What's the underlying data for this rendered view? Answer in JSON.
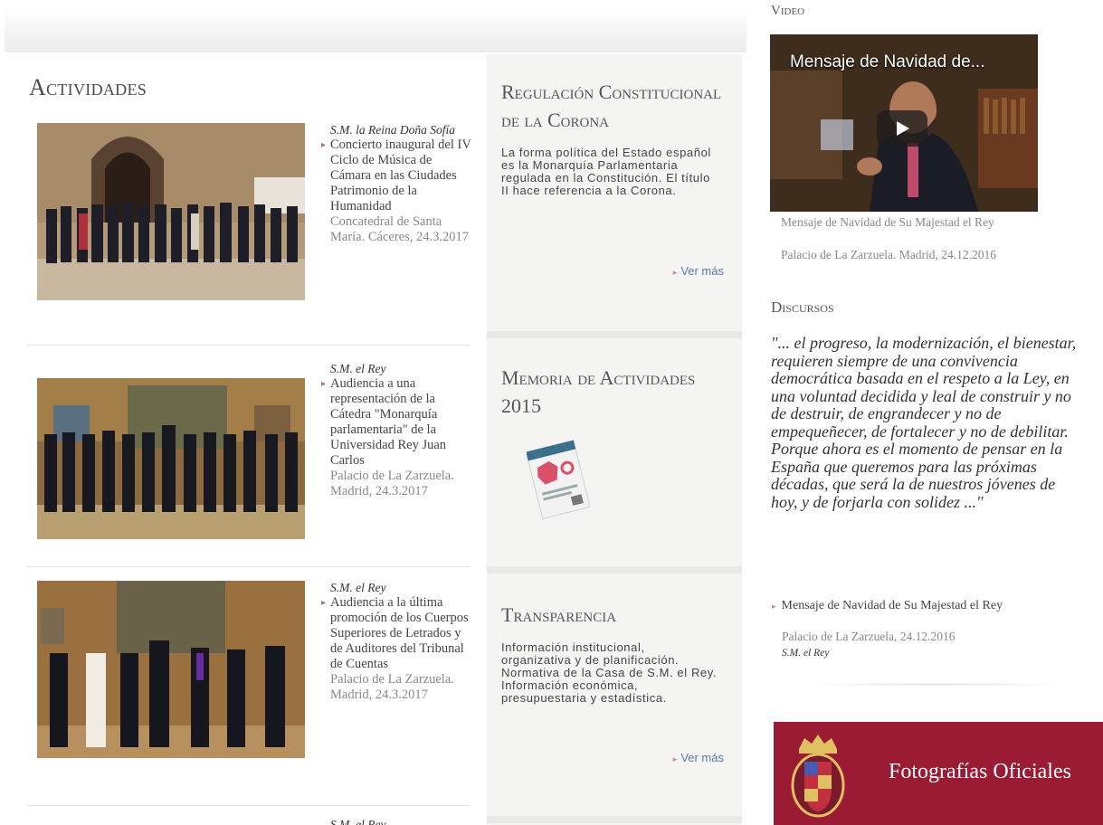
{
  "actividades": {
    "title": "Actividades",
    "items": [
      {
        "who": "S.M. la Reina Doña Sofía",
        "desc": "Concierto inaugural del IV Ciclo de Música de Cámara en las Ciudades Patrimonio de la Humanidad",
        "place": "Concatedral de Santa María. Cáceres, 24.3.2017"
      },
      {
        "who": "S.M. el Rey",
        "desc": "Audiencia a una representación de la Cátedra \"Monarquía parlamentaria\" de la Universidad Rey Juan Carlos",
        "place": "Palacio de La Zarzuela. Madrid, 24.3.2017"
      },
      {
        "who": "S.M. el Rey",
        "desc": "Audiencia a la última promoción de los Cuerpos Superiores de Letrados y de Auditores del Tribunal de Cuentas",
        "place": "Palacio de La Zarzuela. Madrid, 24.3.2017"
      },
      {
        "who": "S.M. el Rey"
      }
    ]
  },
  "regulacion": {
    "title": "Regulación Constitucional de la Corona",
    "text": "La forma política del Estado español es la Monarquía Parlamentaria regulada en la Constitución. El título II hace referencia a la Corona.",
    "link": "Ver más"
  },
  "memoria": {
    "title": "Memoria de Actividades 2015"
  },
  "transparencia": {
    "title": "Transparencia",
    "text": "Información institucional, organizativa y de planificación. Normativa de la Casa de S.M. el Rey. Información económica, presupuestaria y estadística.",
    "link": "Ver más"
  },
  "video": {
    "title": "Video",
    "overlay_title": "Mensaje de Navidad de...",
    "caption": "Mensaje de Navidad de Su Majestad el Rey",
    "place": "Palacio de La Zarzuela. Madrid, 24.12.2016"
  },
  "discursos": {
    "title": "Discursos",
    "quote": "\"... el progreso, la modernización, el bienestar, requieren siempre de una convivencia democrática basada en el respeto a la Ley, en una voluntad decidida y leal de construir y no de destruir, de engrandecer y no de empequeñecer, de fortalecer y no de debilitar. Porque ahora es el momento de pensar en la España que queremos para las próximas décadas, que será la de nuestros jóvenes de hoy, y de forjarla con solidez ...\"",
    "link": "Mensaje de Navidad de Su Majestad el Rey",
    "place": "Palacio de La Zarzuela, 24.12.2016",
    "who": "S.M. el Rey"
  },
  "fotografias": {
    "label": "Fotografías Oficiales"
  },
  "colors": {
    "banner": "#9c1b34",
    "link": "#5a7aa6"
  }
}
